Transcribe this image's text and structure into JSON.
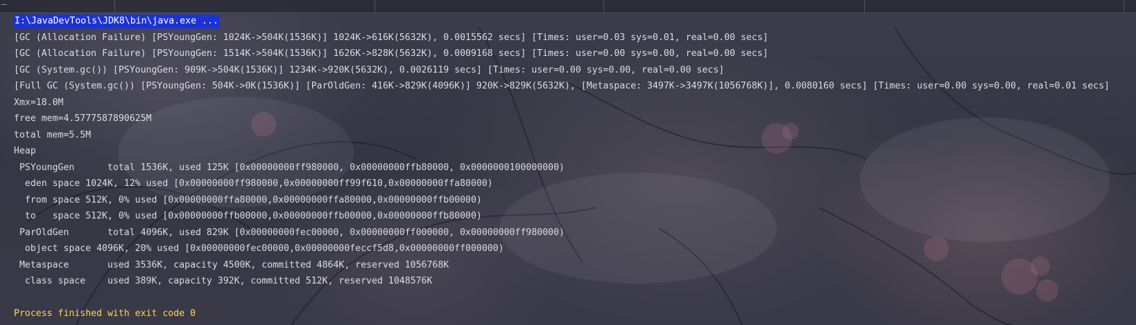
{
  "console": {
    "command": "I:\\JavaDevTools\\JDK8\\bin\\java.exe ...",
    "lines": [
      "[GC (Allocation Failure) [PSYoungGen: 1024K->504K(1536K)] 1024K->616K(5632K), 0.0015562 secs] [Times: user=0.03 sys=0.01, real=0.00 secs]",
      "[GC (Allocation Failure) [PSYoungGen: 1514K->504K(1536K)] 1626K->828K(5632K), 0.0009168 secs] [Times: user=0.00 sys=0.00, real=0.00 secs]",
      "[GC (System.gc()) [PSYoungGen: 909K->504K(1536K)] 1234K->920K(5632K), 0.0026119 secs] [Times: user=0.00 sys=0.00, real=0.00 secs]",
      "[Full GC (System.gc()) [PSYoungGen: 504K->0K(1536K)] [ParOldGen: 416K->829K(4096K)] 920K->829K(5632K), [Metaspace: 3497K->3497K(1056768K)], 0.0080160 secs] [Times: user=0.00 sys=0.00, real=0.01 secs]",
      "Xmx=18.0M",
      "free mem=4.5777587890625M",
      "total mem=5.5M",
      "Heap",
      " PSYoungGen      total 1536K, used 125K [0x00000000ff980000, 0x00000000ffb80000, 0x0000000100000000)",
      "  eden space 1024K, 12% used [0x00000000ff980000,0x00000000ff99f610,0x00000000ffa80000)",
      "  from space 512K, 0% used [0x00000000ffa80000,0x00000000ffa80000,0x00000000ffb00000)",
      "  to   space 512K, 0% used [0x00000000ffb00000,0x00000000ffb00000,0x00000000ffb80000)",
      " ParOldGen       total 4096K, used 829K [0x00000000fec00000, 0x00000000ff000000, 0x00000000ff980000)",
      "  object space 4096K, 20% used [0x00000000fec00000,0x00000000feccf5d8,0x00000000ff000000)",
      " Metaspace       used 3536K, capacity 4500K, committed 4864K, reserved 1056768K",
      "  class space    used 389K, capacity 392K, committed 512K, reserved 1048576K"
    ],
    "exit_message": "Process finished with exit code 0"
  },
  "colors": {
    "command_highlight": "#1b32d8",
    "exit_message": "#ffd84a",
    "text": "#dcdce2"
  },
  "icons": {
    "top_left": "run-tab-icon"
  }
}
